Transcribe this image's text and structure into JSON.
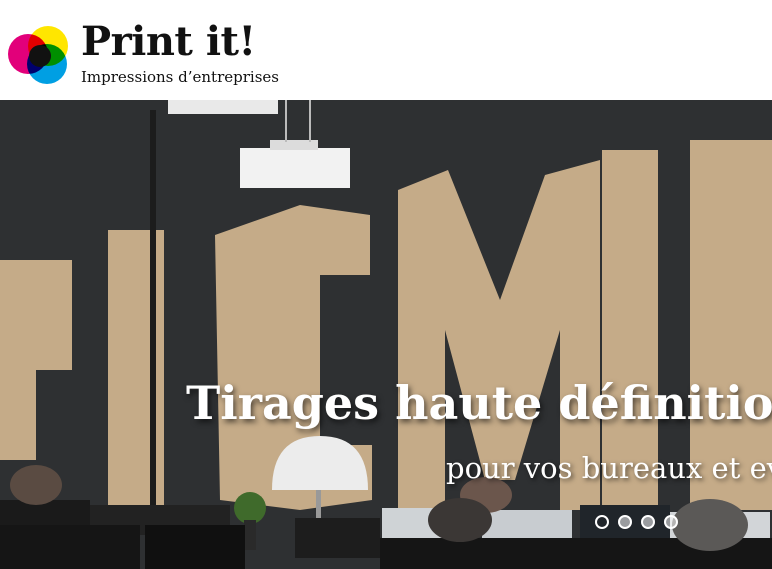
{
  "brand": {
    "title": "Print it!",
    "subtitle": "Impressions d’entreprises",
    "logo_colors": [
      "#e2007a",
      "#ffe600",
      "#009fe3",
      "#111111"
    ]
  },
  "hero": {
    "title": "Tirages haute définition d",
    "subtitle": "pour vos bureaux et eve",
    "slide_count": 4,
    "active_slide": 1
  }
}
